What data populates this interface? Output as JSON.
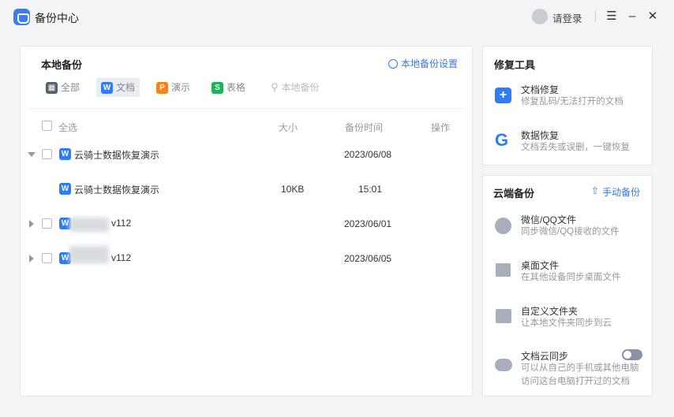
{
  "app": {
    "title": "备份中心",
    "login": "请登录"
  },
  "window_controls": [
    "menu-icon",
    "minimize-icon",
    "close-icon"
  ],
  "local": {
    "title": "本地备份",
    "settings": "本地备份设置",
    "tabs": [
      {
        "label": "全部",
        "icon": "grid-icon"
      },
      {
        "label": "文档",
        "icon": "W",
        "color": "#2f7cf6",
        "active": true
      },
      {
        "label": "演示",
        "icon": "P",
        "color": "#f5821f"
      },
      {
        "label": "表格",
        "icon": "S",
        "color": "#1fb155"
      }
    ],
    "search_placeholder": "本地备份",
    "columns": {
      "select_all": "全选",
      "size": "大小",
      "time": "备份时间",
      "action": "操作"
    },
    "rows": [
      {
        "name": "云骑士数据恢复演示",
        "size": "",
        "time": "2023/06/08",
        "expanded": true
      },
      {
        "name": "云骑士数据恢复演示",
        "size": "10KB",
        "time": "15:01",
        "child": true
      },
      {
        "name_suffix": "v112",
        "size": "",
        "time": "2023/06/01",
        "expanded": false
      },
      {
        "name_suffix": "v112",
        "size": "",
        "time": "2023/06/05",
        "expanded": false
      }
    ]
  },
  "repair": {
    "title": "修复工具",
    "items": [
      {
        "title": "文档修复",
        "desc": "修复乱码/无法打开的文档"
      },
      {
        "title": "数据恢复",
        "desc": "文档丢失或误删，一键恢复"
      }
    ]
  },
  "cloud": {
    "title": "云端备份",
    "manual": "手动备份",
    "items": [
      {
        "title": "微信/QQ文件",
        "desc": "同步微信/QQ接收的文件"
      },
      {
        "title": "桌面文件",
        "desc": "在其他设备同步桌面文件"
      },
      {
        "title": "自定义文件夹",
        "desc": "让本地文件夹同步到云"
      },
      {
        "title": "文档云同步",
        "desc1": "可以从自己的手机或其他电脑",
        "desc2": "访问这台电脑打开过的文档",
        "toggle_on": false
      }
    ]
  },
  "colors": {
    "accent": "#3a78e8"
  }
}
